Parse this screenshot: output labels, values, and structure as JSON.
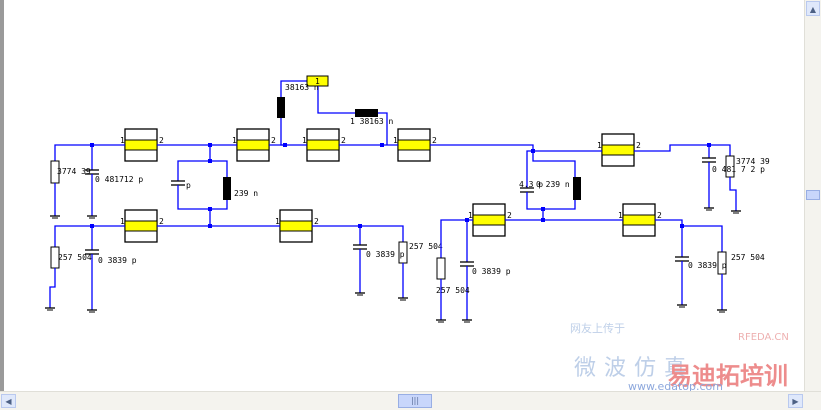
{
  "scrollbars": {
    "up_arrow": "▲",
    "left_arrow": "◀",
    "right_arrow": "▶",
    "thumb_grip": "|||"
  },
  "colors": {
    "wire": "#0000ff",
    "component": "#000000",
    "block_fill": "#ffff00"
  },
  "blocks": [
    {
      "id": "top-1",
      "pin1": "1",
      "pin2": "2"
    },
    {
      "id": "top-2",
      "pin1": "1",
      "pin2": "2"
    },
    {
      "id": "top-3",
      "pin1": "1",
      "pin2": "2"
    },
    {
      "id": "top-4",
      "pin1": "1",
      "pin2": "2"
    },
    {
      "id": "top-5",
      "pin1": "1",
      "pin2": "2"
    },
    {
      "id": "bottom-1",
      "pin1": "1",
      "pin2": "2"
    },
    {
      "id": "bottom-2",
      "pin1": "1",
      "pin2": "2"
    },
    {
      "id": "bottom-3",
      "pin1": "1",
      "pin2": "2"
    },
    {
      "id": "bottom-4",
      "pin1": "1",
      "pin2": "2"
    }
  ],
  "port_label": "1",
  "labels": {
    "r_top_left": "3774 39",
    "c_top_left": "0 481712 p",
    "r_bot_left": "257 504",
    "c_bot_left": "0 3839 p",
    "c_mid_left": "p",
    "l_mid_left": "239 n",
    "l_top_vertical": "38163 n",
    "l_top_horizontal": "1 38163 n",
    "c_bot_mid": "0 3839 p",
    "r_bot_mid": "257 504",
    "c_mid_right": "4.3 p",
    "l_mid_right": "0 239 n",
    "r_bot_right1": "257 504",
    "c_bot_right1": "0 3839 p",
    "c_bot_right2": "0 3839 p",
    "r_bot_right2": "257 504",
    "r_top_right": "3774 39",
    "c_top_right": "0 481 7 2 p"
  },
  "watermark": {
    "line1": "网友上传于",
    "brand": "RFEDA.CN",
    "line2": "微波仿真",
    "cn_brand": "易迪拓培训",
    "url": "www.edatop.com"
  }
}
